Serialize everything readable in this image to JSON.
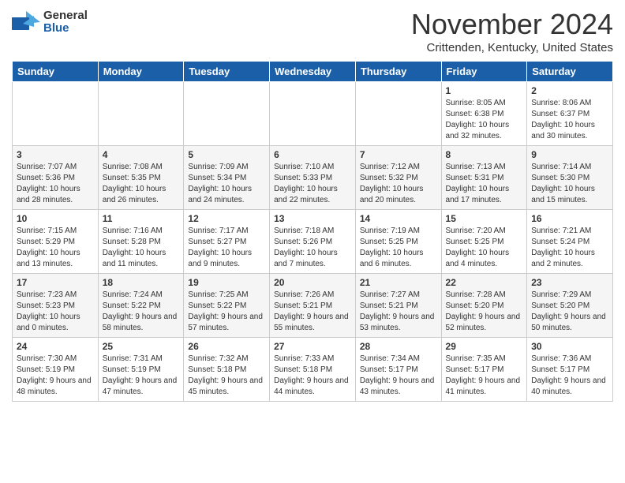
{
  "header": {
    "logo_general": "General",
    "logo_blue": "Blue",
    "month_title": "November 2024",
    "location": "Crittenden, Kentucky, United States"
  },
  "days_of_week": [
    "Sunday",
    "Monday",
    "Tuesday",
    "Wednesday",
    "Thursday",
    "Friday",
    "Saturday"
  ],
  "weeks": [
    [
      {
        "day": "",
        "info": ""
      },
      {
        "day": "",
        "info": ""
      },
      {
        "day": "",
        "info": ""
      },
      {
        "day": "",
        "info": ""
      },
      {
        "day": "",
        "info": ""
      },
      {
        "day": "1",
        "info": "Sunrise: 8:05 AM\nSunset: 6:38 PM\nDaylight: 10 hours and 32 minutes."
      },
      {
        "day": "2",
        "info": "Sunrise: 8:06 AM\nSunset: 6:37 PM\nDaylight: 10 hours and 30 minutes."
      }
    ],
    [
      {
        "day": "3",
        "info": "Sunrise: 7:07 AM\nSunset: 5:36 PM\nDaylight: 10 hours and 28 minutes."
      },
      {
        "day": "4",
        "info": "Sunrise: 7:08 AM\nSunset: 5:35 PM\nDaylight: 10 hours and 26 minutes."
      },
      {
        "day": "5",
        "info": "Sunrise: 7:09 AM\nSunset: 5:34 PM\nDaylight: 10 hours and 24 minutes."
      },
      {
        "day": "6",
        "info": "Sunrise: 7:10 AM\nSunset: 5:33 PM\nDaylight: 10 hours and 22 minutes."
      },
      {
        "day": "7",
        "info": "Sunrise: 7:12 AM\nSunset: 5:32 PM\nDaylight: 10 hours and 20 minutes."
      },
      {
        "day": "8",
        "info": "Sunrise: 7:13 AM\nSunset: 5:31 PM\nDaylight: 10 hours and 17 minutes."
      },
      {
        "day": "9",
        "info": "Sunrise: 7:14 AM\nSunset: 5:30 PM\nDaylight: 10 hours and 15 minutes."
      }
    ],
    [
      {
        "day": "10",
        "info": "Sunrise: 7:15 AM\nSunset: 5:29 PM\nDaylight: 10 hours and 13 minutes."
      },
      {
        "day": "11",
        "info": "Sunrise: 7:16 AM\nSunset: 5:28 PM\nDaylight: 10 hours and 11 minutes."
      },
      {
        "day": "12",
        "info": "Sunrise: 7:17 AM\nSunset: 5:27 PM\nDaylight: 10 hours and 9 minutes."
      },
      {
        "day": "13",
        "info": "Sunrise: 7:18 AM\nSunset: 5:26 PM\nDaylight: 10 hours and 7 minutes."
      },
      {
        "day": "14",
        "info": "Sunrise: 7:19 AM\nSunset: 5:25 PM\nDaylight: 10 hours and 6 minutes."
      },
      {
        "day": "15",
        "info": "Sunrise: 7:20 AM\nSunset: 5:25 PM\nDaylight: 10 hours and 4 minutes."
      },
      {
        "day": "16",
        "info": "Sunrise: 7:21 AM\nSunset: 5:24 PM\nDaylight: 10 hours and 2 minutes."
      }
    ],
    [
      {
        "day": "17",
        "info": "Sunrise: 7:23 AM\nSunset: 5:23 PM\nDaylight: 10 hours and 0 minutes."
      },
      {
        "day": "18",
        "info": "Sunrise: 7:24 AM\nSunset: 5:22 PM\nDaylight: 9 hours and 58 minutes."
      },
      {
        "day": "19",
        "info": "Sunrise: 7:25 AM\nSunset: 5:22 PM\nDaylight: 9 hours and 57 minutes."
      },
      {
        "day": "20",
        "info": "Sunrise: 7:26 AM\nSunset: 5:21 PM\nDaylight: 9 hours and 55 minutes."
      },
      {
        "day": "21",
        "info": "Sunrise: 7:27 AM\nSunset: 5:21 PM\nDaylight: 9 hours and 53 minutes."
      },
      {
        "day": "22",
        "info": "Sunrise: 7:28 AM\nSunset: 5:20 PM\nDaylight: 9 hours and 52 minutes."
      },
      {
        "day": "23",
        "info": "Sunrise: 7:29 AM\nSunset: 5:20 PM\nDaylight: 9 hours and 50 minutes."
      }
    ],
    [
      {
        "day": "24",
        "info": "Sunrise: 7:30 AM\nSunset: 5:19 PM\nDaylight: 9 hours and 48 minutes."
      },
      {
        "day": "25",
        "info": "Sunrise: 7:31 AM\nSunset: 5:19 PM\nDaylight: 9 hours and 47 minutes."
      },
      {
        "day": "26",
        "info": "Sunrise: 7:32 AM\nSunset: 5:18 PM\nDaylight: 9 hours and 45 minutes."
      },
      {
        "day": "27",
        "info": "Sunrise: 7:33 AM\nSunset: 5:18 PM\nDaylight: 9 hours and 44 minutes."
      },
      {
        "day": "28",
        "info": "Sunrise: 7:34 AM\nSunset: 5:17 PM\nDaylight: 9 hours and 43 minutes."
      },
      {
        "day": "29",
        "info": "Sunrise: 7:35 AM\nSunset: 5:17 PM\nDaylight: 9 hours and 41 minutes."
      },
      {
        "day": "30",
        "info": "Sunrise: 7:36 AM\nSunset: 5:17 PM\nDaylight: 9 hours and 40 minutes."
      }
    ]
  ]
}
